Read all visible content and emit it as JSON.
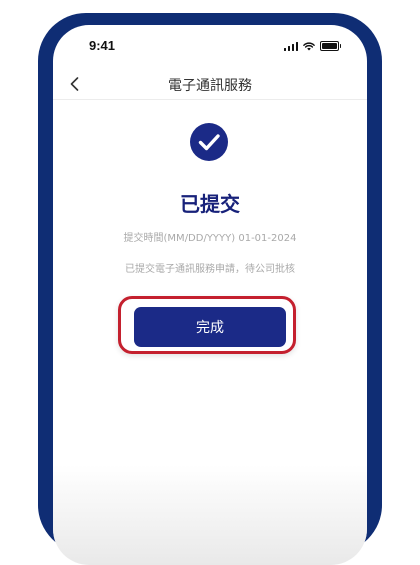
{
  "status_bar": {
    "time": "9:41"
  },
  "nav": {
    "title": "電子通訊服務"
  },
  "result": {
    "title": "已提交",
    "submit_time": "提交時間(MM/DD/YYYY) 01-01-2024",
    "message": "已提交電子通訊服務申請，待公司批核"
  },
  "actions": {
    "done_label": "完成"
  },
  "colors": {
    "frame": "#0f2d74",
    "accent": "#1b2a87",
    "title": "#17217a",
    "highlight": "#c4202e"
  },
  "icons": {
    "back": "chevron-left-icon",
    "success": "check-circle-icon",
    "signal": "signal-icon",
    "wifi": "wifi-icon",
    "battery": "battery-icon"
  }
}
